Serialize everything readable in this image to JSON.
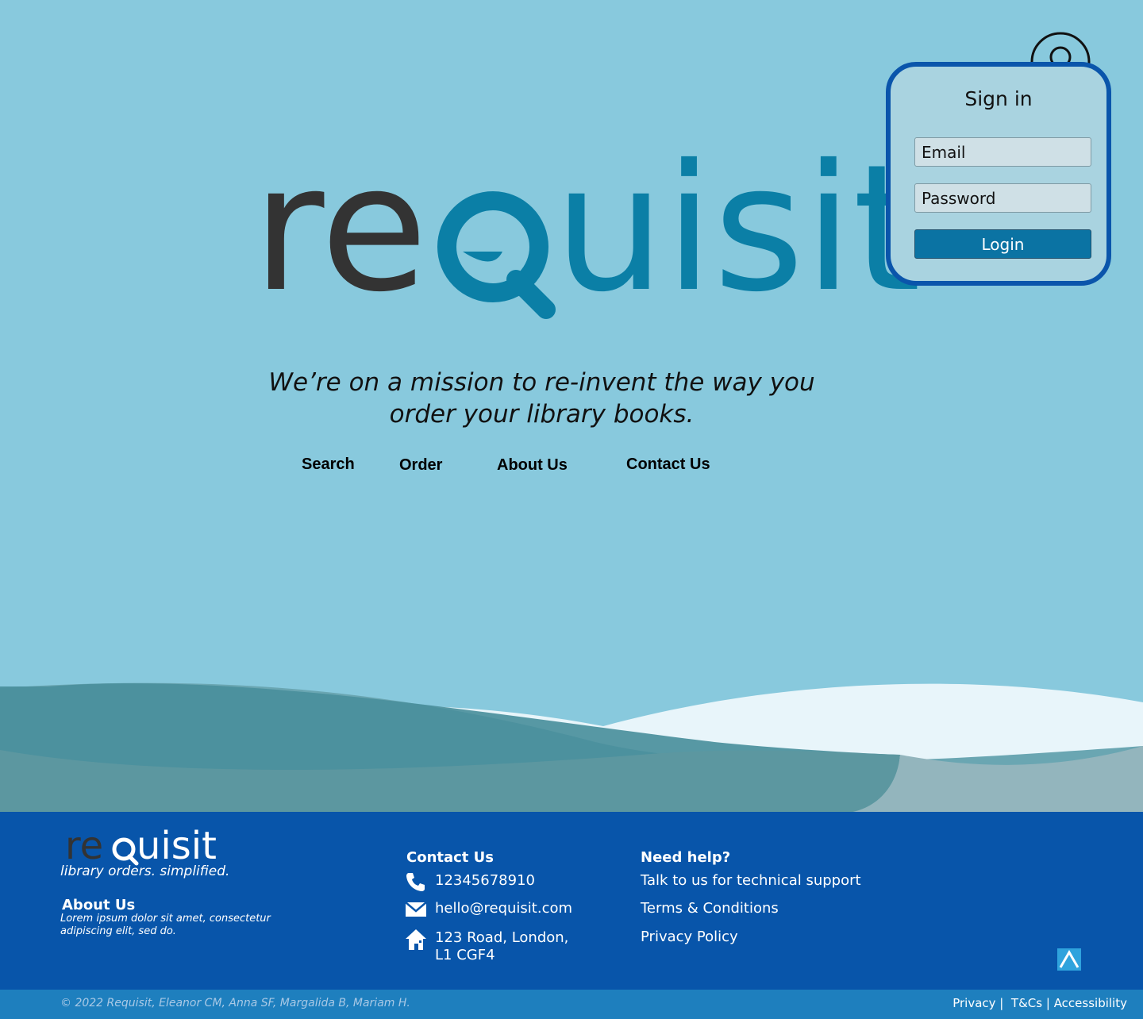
{
  "brand": {
    "logo_part1": "re",
    "logo_part2": "quisit",
    "slogan": "library orders. simplified.",
    "colors": {
      "dark": "#333333",
      "blue": "#0b7fa6",
      "footer_blue": "#0855aa",
      "background": "#88c9dd"
    }
  },
  "header": {
    "account_icon": "user-icon"
  },
  "signin": {
    "title": "Sign in",
    "email_placeholder": "Email",
    "password_placeholder": "Password",
    "login_label": "Login"
  },
  "hero": {
    "tagline_line1": "We’re on a mission to re-invent the way you",
    "tagline_line2": "order your library books."
  },
  "nav": {
    "items": [
      {
        "label": "Search"
      },
      {
        "label": "Order"
      },
      {
        "label": "About Us"
      },
      {
        "label": "Contact Us"
      }
    ]
  },
  "footer": {
    "about": {
      "heading": "About Us",
      "text": "Lorem ipsum dolor sit amet, consectetur adipiscing elit, sed do."
    },
    "contact": {
      "heading": "Contact Us",
      "phone": "12345678910",
      "email": "hello@requisit.com",
      "address_line1": "123 Road, London,",
      "address_line2": "L1 CGF4",
      "icons": [
        "phone-icon",
        "mail-icon",
        "home-icon"
      ]
    },
    "help": {
      "heading": "Need help?",
      "links": [
        {
          "label": "Talk to us for technical support"
        },
        {
          "label": "Terms & Conditions"
        },
        {
          "label": "Privacy Policy"
        }
      ]
    },
    "scroll_top_icon": "chevron-up-icon"
  },
  "bottom_bar": {
    "copyright": "© 2022 Requisit, Eleanor CM, Anna SF, Margalida B, Mariam H.",
    "links": [
      {
        "label": "Privacy"
      },
      {
        "label": "T&Cs"
      },
      {
        "label": "Accessibility"
      }
    ],
    "separator": "|"
  }
}
